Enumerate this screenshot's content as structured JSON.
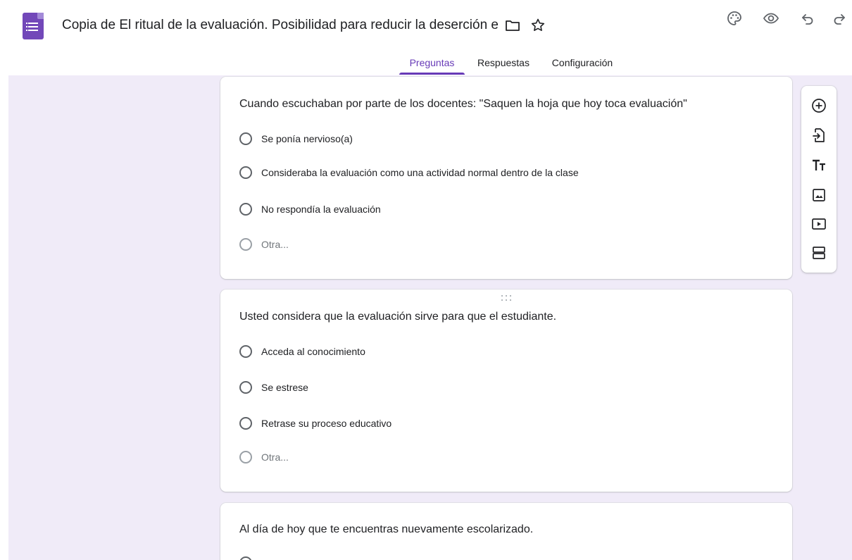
{
  "document": {
    "title": "Copia de El ritual de la evaluación. Posibilidad para reducir la deserción escolar"
  },
  "header": {
    "app_icon": "google-forms-icon",
    "title_icons": [
      "folder-icon",
      "star-icon"
    ],
    "actions": [
      "palette-icon",
      "eye-icon",
      "undo-icon",
      "redo-icon"
    ]
  },
  "tabs": [
    {
      "label": "Preguntas",
      "active": true
    },
    {
      "label": "Respuestas",
      "active": false
    },
    {
      "label": "Configuración",
      "active": false
    }
  ],
  "questions": [
    {
      "title": "Cuando escuchaban por parte de los docentes: \"Saquen la hoja que hoy toca evaluación\"",
      "options": [
        "Se ponía nervioso(a)",
        "Consideraba la evaluación como una actividad normal dentro de la clase",
        "No respondía la evaluación"
      ],
      "other_label": "Otra..."
    },
    {
      "title": "Usted considera que la evaluación sirve para que el estudiante.",
      "options": [
        "Acceda al conocimiento",
        "Se estrese",
        "Retrase su proceso educativo"
      ],
      "other_label": "Otra..."
    },
    {
      "title": "Al día de hoy que te encuentras nuevamente  escolarizado."
    }
  ],
  "toolbar": {
    "tools": [
      "add-question-icon",
      "import-questions-icon",
      "add-title-icon",
      "add-image-icon",
      "add-video-icon",
      "add-section-icon"
    ]
  },
  "colors": {
    "accent": "#673ab7",
    "background": "#f0ebf8",
    "card": "#ffffff",
    "icon": "#5f6368"
  }
}
